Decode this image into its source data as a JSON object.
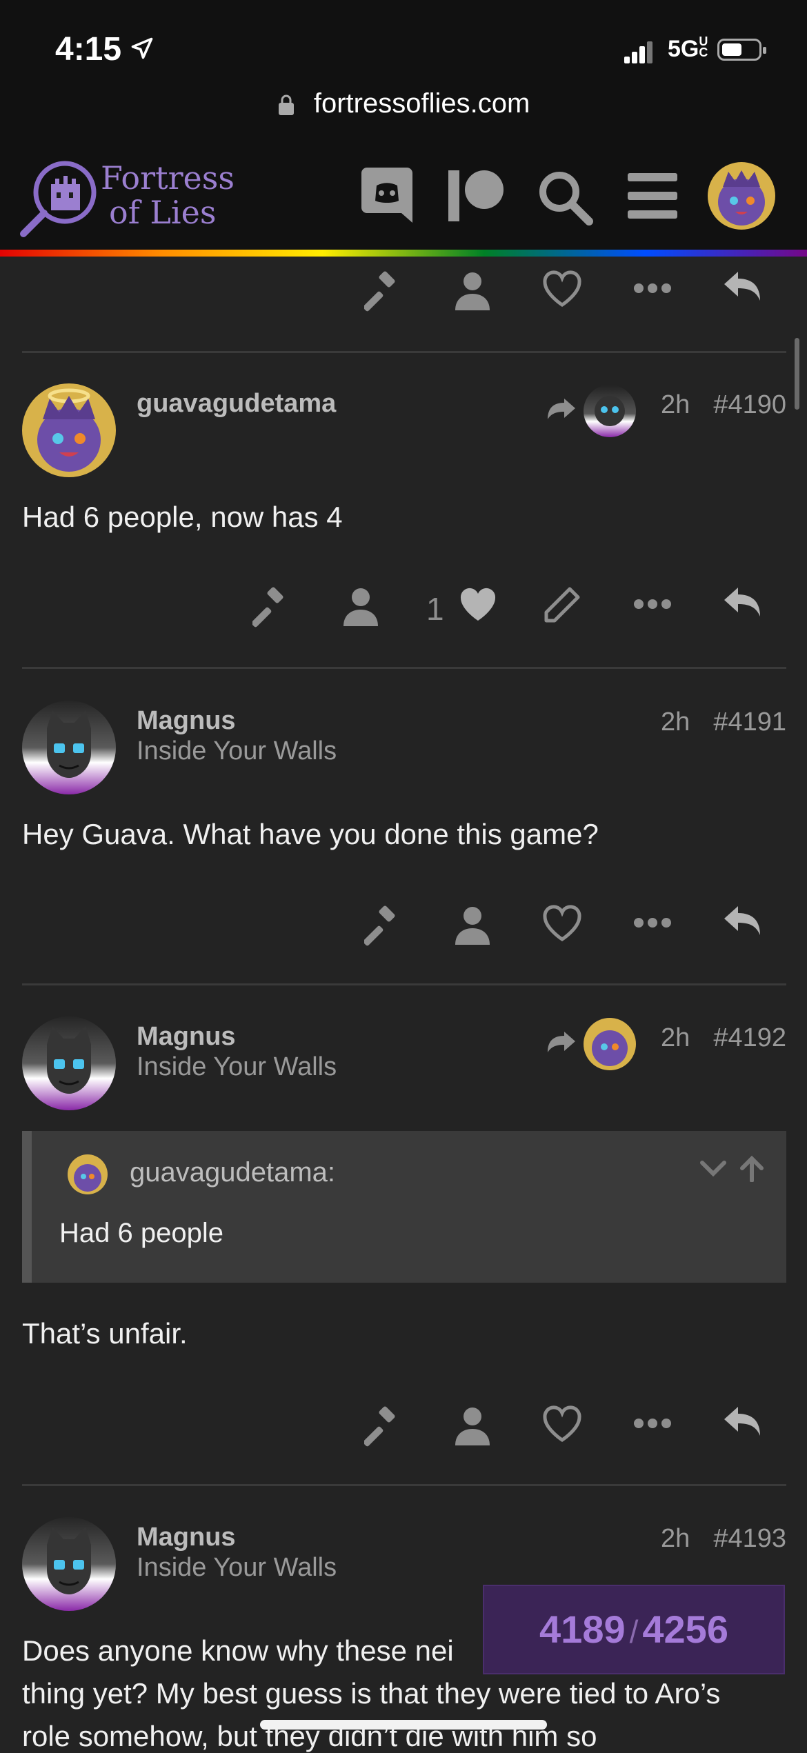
{
  "status_bar": {
    "time": "4:15",
    "network": "5G",
    "network_suffix": "UC"
  },
  "browser": {
    "url": "fortressoflies.com"
  },
  "site": {
    "logo_line1": "Fortress",
    "logo_line2": "of Lies",
    "header_icons": [
      "discord-icon",
      "patreon-icon",
      "search-icon",
      "menu-icon",
      "user-avatar"
    ]
  },
  "posts": [
    {
      "username": "guavagudetama",
      "user_title": "",
      "time": "2h",
      "number": "#4190",
      "body": "Had 6 people, now has 4",
      "like_count": "1"
    },
    {
      "username": "Magnus",
      "user_title": "Inside Your Walls",
      "time": "2h",
      "number": "#4191",
      "body": "Hey Guava. What have you done this game?"
    },
    {
      "username": "Magnus",
      "user_title": "Inside Your Walls",
      "time": "2h",
      "number": "#4192",
      "quote_user": "guavagudetama:",
      "quote_text": "Had 6 people",
      "body": "That’s unfair."
    },
    {
      "username": "Magnus",
      "user_title": "Inside Your Walls",
      "time": "2h",
      "number": "#4193",
      "body_line1": "Does anyone know why these nei",
      "body_line2": "thing yet? My best guess is that they were tied to Aro’s",
      "body_line3": "role somehow, but they didn’t die with him so"
    }
  ],
  "progress": {
    "current": "4189",
    "separator": "/",
    "total": "4256"
  },
  "colors": {
    "accent": "#9b7fd0",
    "progress_bg": "#3b2456",
    "background": "#232323"
  }
}
